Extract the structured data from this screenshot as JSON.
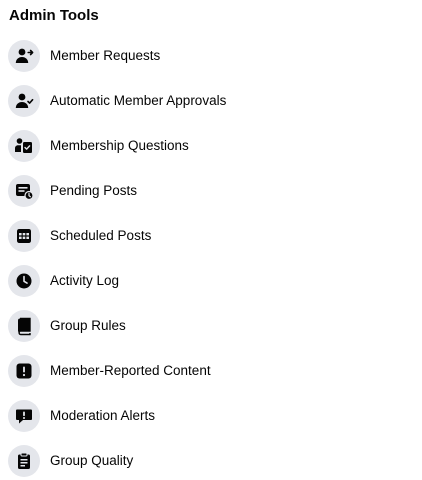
{
  "section": {
    "title": "Admin Tools"
  },
  "items": [
    {
      "label": "Member Requests",
      "icon": "person-add-icon"
    },
    {
      "label": "Automatic Member Approvals",
      "icon": "person-check-icon"
    },
    {
      "label": "Membership Questions",
      "icon": "person-clipboard-icon"
    },
    {
      "label": "Pending Posts",
      "icon": "pending-post-icon"
    },
    {
      "label": "Scheduled Posts",
      "icon": "calendar-icon"
    },
    {
      "label": "Activity Log",
      "icon": "clock-icon"
    },
    {
      "label": "Group Rules",
      "icon": "book-icon"
    },
    {
      "label": "Member-Reported Content",
      "icon": "alert-icon"
    },
    {
      "label": "Moderation Alerts",
      "icon": "flag-bubble-icon"
    },
    {
      "label": "Group Quality",
      "icon": "clipboard-icon"
    }
  ],
  "colors": {
    "icon_bg": "#e4e6eb",
    "icon_fg": "#050505",
    "text": "#050505"
  }
}
